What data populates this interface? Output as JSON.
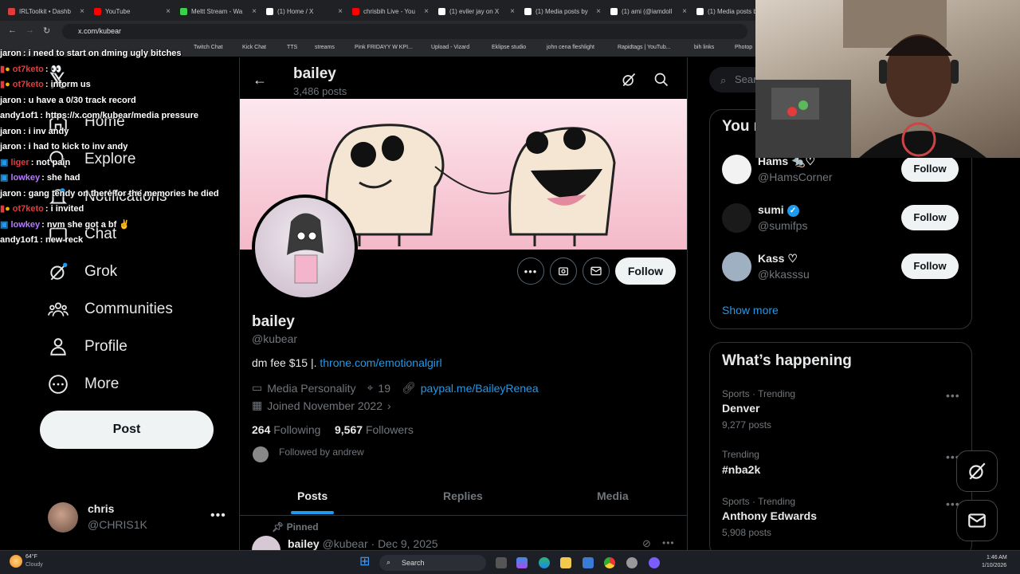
{
  "browser": {
    "tabs": [
      {
        "title": "IRLToolkit • Dashb",
        "color": "#e23b3b"
      },
      {
        "title": "YouTube",
        "color": "#ff0000"
      },
      {
        "title": "Meltt Stream - Wa",
        "color": "#3bd14a"
      },
      {
        "title": "(1) Home / X",
        "color": "#ffffff"
      },
      {
        "title": "chrisbih Live - You",
        "color": "#ff0000"
      },
      {
        "title": "(1) eviler jay on X",
        "color": "#ffffff"
      },
      {
        "title": "(1) Media posts by",
        "color": "#ffffff"
      },
      {
        "title": "(1) ami (@iamdoll",
        "color": "#ffffff"
      },
      {
        "title": "(1) Media posts by",
        "color": "#ffffff"
      }
    ],
    "url": "x.com/kubear",
    "bookmarks": [
      "Twitch Chat",
      "Kick Chat",
      "TTS",
      "streams",
      "Pink FRIDAYY W KPI...",
      "Upload - Vizard",
      "Eklipse studio",
      "john cena fleshlight",
      "Rapidtags | YouTub...",
      "bih links",
      "Photop"
    ]
  },
  "nav": {
    "items": [
      "Home",
      "Explore",
      "Notifications",
      "Chat",
      "Grok",
      "Communities",
      "Profile",
      "More"
    ],
    "post_label": "Post",
    "account_name": "chris",
    "account_handle": "@CHRIS1K"
  },
  "chat": [
    {
      "user": "jaron",
      "color": "#ffffff",
      "text": ": i need to start on dming ugly bitches"
    },
    {
      "user": "ot7keto",
      "color": "#e23b3b",
      "text": ": 👀"
    },
    {
      "user": "ot7keto",
      "color": "#e23b3b",
      "text": ": inform us"
    },
    {
      "user": "jaron",
      "color": "#ffffff",
      "text": ": u have a 0/30 track record"
    },
    {
      "user": "andy1of1",
      "color": "#ffffff",
      "text": ": https://x.com/kubear/media pressure"
    },
    {
      "user": "jaron",
      "color": "#ffffff",
      "text": ": i inv andy"
    },
    {
      "user": "jaron",
      "color": "#ffffff",
      "text": ": i had to kick to inv andy"
    },
    {
      "user": "liger",
      "color": "#e23b3b",
      "text": ": not pain"
    },
    {
      "user": "lowkey",
      "color": "#b57cff",
      "text": ": she had"
    },
    {
      "user": "jaron",
      "color": "#ffffff",
      "text": ": gang tendy on there for the memories he died"
    },
    {
      "user": "ot7keto",
      "color": "#e23b3b",
      "text": ": i invited"
    },
    {
      "user": "lowkey",
      "color": "#b57cff",
      "text": ": nvm she got a bf ✌"
    },
    {
      "user": "andy1of1",
      "color": "#ffffff",
      "text": ": new reck"
    }
  ],
  "profile": {
    "header_name": "bailey",
    "post_count": "3,486 posts",
    "name": "bailey",
    "handle": "@kubear",
    "bio_text": "dm fee $15  |.",
    "bio_link": "throne.com/emotionalgirl",
    "category": "Media Personality",
    "location": "19",
    "website": "paypal.me/BaileyRenea",
    "joined": "Joined November 2022",
    "following_count": "264",
    "following_label": "Following",
    "followers_count": "9,567",
    "followers_label": "Followers",
    "followed_by": "Followed by andrew",
    "follow_label": "Follow",
    "tabs": [
      "Posts",
      "Replies",
      "Media"
    ],
    "pinned_label": "Pinned",
    "pinned_name": "bailey",
    "pinned_handle": "@kubear",
    "pinned_date": "· Dec 9, 2025"
  },
  "right": {
    "search_placeholder": "Search",
    "you_might_like": "You might like",
    "who": [
      {
        "name": "Hams 🐀♡",
        "handle": "@HamsCorner",
        "btn": "Follow"
      },
      {
        "name": "sumi",
        "handle": "@sumifps",
        "btn": "Follow"
      },
      {
        "name": "Kass ♡",
        "handle": "@kkasssu",
        "btn": "Follow"
      }
    ],
    "show_more": "Show more",
    "happening_title": "What’s happening",
    "trends": [
      {
        "context": "Sports · Trending",
        "title": "Denver",
        "count": "9,277 posts"
      },
      {
        "context": "Trending",
        "title": "#nba2k",
        "count": ""
      },
      {
        "context": "Sports · Trending",
        "title": "Anthony Edwards",
        "count": "5,908 posts"
      }
    ]
  },
  "taskbar": {
    "weather_temp": "64°F",
    "weather_desc": "Cloudy",
    "search": "Search",
    "time": "1:46 AM",
    "date": "1/10/2026"
  }
}
